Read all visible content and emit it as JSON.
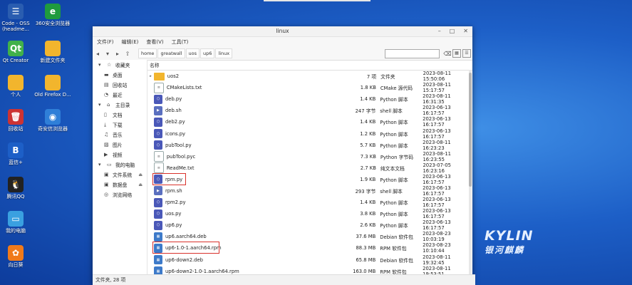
{
  "desktop": {
    "icons": [
      {
        "label": "Code - OSS (headme...",
        "icon": "code-oss-icon",
        "glyph": "☰",
        "color": "#2a5db0"
      },
      {
        "label": "360安全浏览器",
        "icon": "browser-360-icon",
        "glyph": "e",
        "color": "#1f9b3e"
      },
      {
        "label": "Qt Creator",
        "icon": "qt-creator-icon",
        "glyph": "Qt",
        "color": "#41b14a"
      },
      {
        "label": "新建文件夹",
        "icon": "folder-icon",
        "glyph": "",
        "color": "#f2b52d"
      },
      {
        "label": "个人",
        "icon": "folder-icon",
        "glyph": "",
        "color": "#f2b52d"
      },
      {
        "label": "Old Firefox D...",
        "icon": "folder-icon",
        "glyph": "",
        "color": "#f2b52d"
      },
      {
        "label": "回收站",
        "icon": "trash-icon",
        "glyph": "🗑",
        "color": "#cc3333"
      },
      {
        "label": "奇安信浏览器",
        "icon": "qianxin-browser-icon",
        "glyph": "◉",
        "color": "#2f7fd8"
      },
      {
        "label": "蓝信+",
        "icon": "lanxin-icon",
        "glyph": "B",
        "color": "#1d5fc7"
      },
      {
        "label": "腾讯QQ",
        "icon": "qq-icon",
        "glyph": "🐧",
        "color": "#222222"
      },
      {
        "label": "我的电脑",
        "icon": "computer-icon",
        "glyph": "▭",
        "color": "#3aa0e0"
      },
      {
        "label": "向日葵",
        "icon": "sunlogin-icon",
        "glyph": "✿",
        "color": "#f07a1a"
      }
    ]
  },
  "window": {
    "title": "linux",
    "menu": [
      "文件(F)",
      "编辑(E)",
      "查看(V)",
      "工具(T)"
    ],
    "breadcrumb": [
      "home",
      "greatwall",
      "uos",
      "up6",
      "linux"
    ],
    "search_placeholder": "",
    "sidebar": [
      {
        "label": "收藏夹",
        "icon": "star-icon",
        "group": true
      },
      {
        "label": "桌面",
        "icon": "desktop-icon",
        "group": false
      },
      {
        "label": "回收站",
        "icon": "trash-icon",
        "group": false
      },
      {
        "label": "最近",
        "icon": "clock-icon",
        "group": false
      },
      {
        "label": "主目录",
        "icon": "home-icon",
        "group": true
      },
      {
        "label": "文档",
        "icon": "document-icon",
        "group": false
      },
      {
        "label": "下载",
        "icon": "download-icon",
        "group": false
      },
      {
        "label": "音乐",
        "icon": "music-icon",
        "group": false
      },
      {
        "label": "图片",
        "icon": "picture-icon",
        "group": false
      },
      {
        "label": "视频",
        "icon": "video-icon",
        "group": false
      },
      {
        "label": "我的电脑",
        "icon": "computer-icon",
        "group": true
      },
      {
        "label": "文件系统",
        "icon": "drive-icon",
        "group": false
      },
      {
        "label": "数据盘",
        "icon": "drive-icon",
        "group": false
      },
      {
        "label": "浏览网络",
        "icon": "network-icon",
        "group": false
      }
    ],
    "columns": {
      "name": "名称",
      "size": "",
      "type": "",
      "date": ""
    },
    "files": [
      {
        "name": "uos2",
        "size": "7 项",
        "type": "文件夹",
        "date": "2023-08-11 15:50:06",
        "kind": "folder",
        "expandable": true
      },
      {
        "name": "CMakeLists.txt",
        "size": "1.8 KB",
        "type": "CMake 源代码",
        "date": "2023-08-11 15:17:57",
        "kind": "text"
      },
      {
        "name": "deb.py",
        "size": "1.4 KB",
        "type": "Python 脚本",
        "date": "2023-08-11 16:31:35",
        "kind": "py"
      },
      {
        "name": "deb.sh",
        "size": "247 字节",
        "type": "shell 脚本",
        "date": "2023-06-13 16:17:57",
        "kind": "shell"
      },
      {
        "name": "deb2.py",
        "size": "1.4 KB",
        "type": "Python 脚本",
        "date": "2023-06-13 16:17:57",
        "kind": "py"
      },
      {
        "name": "icons.py",
        "size": "1.2 KB",
        "type": "Python 脚本",
        "date": "2023-06-13 16:17:57",
        "kind": "py"
      },
      {
        "name": "pubTool.py",
        "size": "5.7 KB",
        "type": "Python 脚本",
        "date": "2023-08-11 16:23:23",
        "kind": "py"
      },
      {
        "name": "pubTool.pyc",
        "size": "7.3 KB",
        "type": "Python 字节码",
        "date": "2023-08-11 16:23:55",
        "kind": "text"
      },
      {
        "name": "ReadMe.txt",
        "size": "2.7 KB",
        "type": "纯文本文档",
        "date": "2023-07-05 16:23:16",
        "kind": "text"
      },
      {
        "name": "rpm.py",
        "size": "1.9 KB",
        "type": "Python 脚本",
        "date": "2023-06-13 16:17:57",
        "kind": "py",
        "highlight": true
      },
      {
        "name": "rpm.sh",
        "size": "293 字节",
        "type": "shell 脚本",
        "date": "2023-06-13 16:17:57",
        "kind": "shell"
      },
      {
        "name": "rpm2.py",
        "size": "1.4 KB",
        "type": "Python 脚本",
        "date": "2023-06-13 16:17:57",
        "kind": "py"
      },
      {
        "name": "uos.py",
        "size": "3.8 KB",
        "type": "Python 脚本",
        "date": "2023-06-13 16:17:57",
        "kind": "py"
      },
      {
        "name": "up6.py",
        "size": "2.6 KB",
        "type": "Python 脚本",
        "date": "2023-06-13 16:17:57",
        "kind": "py"
      },
      {
        "name": "up6.aarch64.deb",
        "size": "37.6 MB",
        "type": "Debian 软件包",
        "date": "2023-08-23 10:03:19",
        "kind": "pkg"
      },
      {
        "name": "up6-1.0-1.aarch64.rpm",
        "size": "88.3 MB",
        "type": "RPM 软件包",
        "date": "2023-08-23 10:10:44",
        "kind": "pkg",
        "highlight": true
      },
      {
        "name": "up6-down2.deb",
        "size": "65.8 MB",
        "type": "Debian 软件包",
        "date": "2023-08-11 19:32:45",
        "kind": "pkg"
      },
      {
        "name": "up6-down2-1.0-1.aarch64.rpm",
        "size": "163.0 MB",
        "type": "RPM 软件包",
        "date": "2023-08-11 19:53:51",
        "kind": "pkg"
      }
    ],
    "status": "文件夹, 28 项"
  },
  "brand": {
    "en": "KYLIN",
    "cn": "银河麒麟"
  }
}
